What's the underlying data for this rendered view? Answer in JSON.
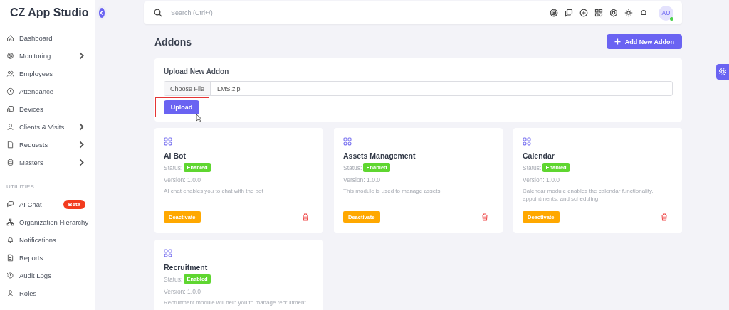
{
  "brand": {
    "title": "CZ App Studio"
  },
  "sidebar": {
    "items": [
      {
        "label": "Dashboard",
        "has_submenu": false
      },
      {
        "label": "Monitoring",
        "has_submenu": true
      },
      {
        "label": "Employees",
        "has_submenu": false
      },
      {
        "label": "Attendance",
        "has_submenu": false
      },
      {
        "label": "Devices",
        "has_submenu": false
      },
      {
        "label": "Clients & Visits",
        "has_submenu": true
      },
      {
        "label": "Requests",
        "has_submenu": true
      },
      {
        "label": "Masters",
        "has_submenu": true
      }
    ],
    "section_label": "UTILITIES",
    "utility_items": [
      {
        "label": "AI Chat",
        "badge": "Beta"
      },
      {
        "label": "Organization Hierarchy"
      },
      {
        "label": "Notifications"
      },
      {
        "label": "Reports"
      },
      {
        "label": "Audit Logs"
      },
      {
        "label": "Roles"
      }
    ]
  },
  "topbar": {
    "search": {
      "placeholder": "Search (Ctrl+/)"
    },
    "avatar": {
      "initials": "AU",
      "online": true
    }
  },
  "page": {
    "title": "Addons",
    "add_button": "Add New Addon"
  },
  "upload": {
    "title": "Upload New Addon",
    "choose_button": "Choose File",
    "file_name": "LMS.zip",
    "upload_button": "Upload",
    "highlighted": true
  },
  "addons": [
    {
      "name": "AI Bot",
      "status_label": "Status:",
      "status": "Enabled",
      "version": "Version: 1.0.0",
      "description": "AI chat enables you to chat with the bot",
      "action": "Deactivate"
    },
    {
      "name": "Assets Management",
      "status_label": "Status:",
      "status": "Enabled",
      "version": "Version: 1.0.0",
      "description": "This module is used to manage assets.",
      "action": "Deactivate"
    },
    {
      "name": "Calendar",
      "status_label": "Status:",
      "status": "Enabled",
      "version": "Version: 1.0.0",
      "description": "Calendar module enables the calendar functionality, appointments, and scheduling.",
      "action": "Deactivate"
    },
    {
      "name": "Recruitment",
      "status_label": "Status:",
      "status": "Enabled",
      "version": "Version: 1.0.0",
      "description": "Recruitment module will help you to manage recruitment"
    }
  ]
}
